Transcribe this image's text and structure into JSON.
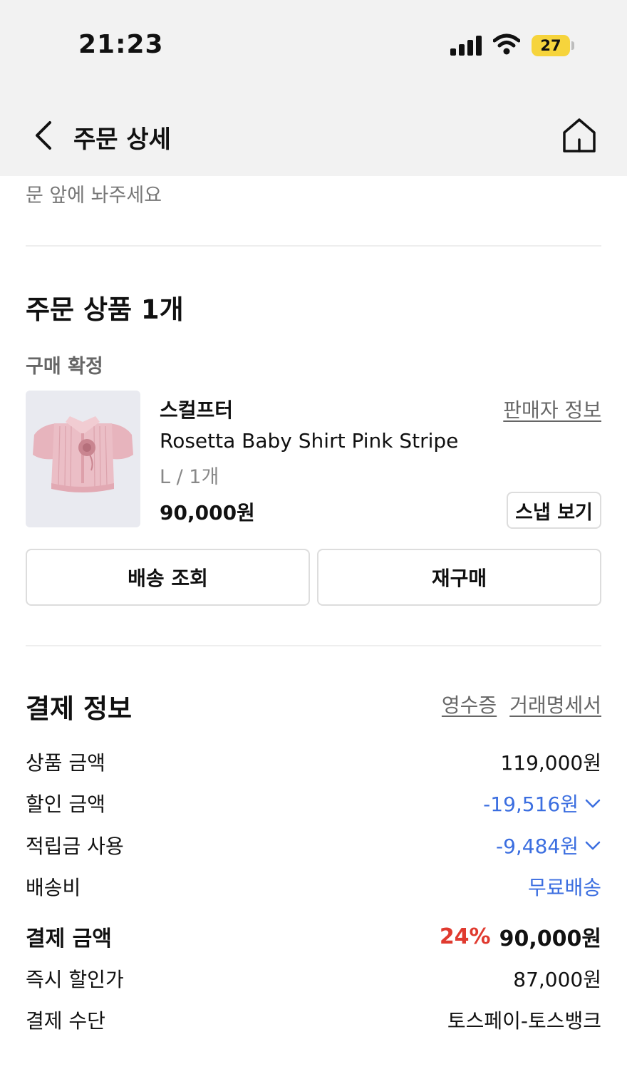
{
  "status_bar": {
    "time": "21:23",
    "battery": "27"
  },
  "nav": {
    "title": "주문 상세",
    "back_icon": "chevron-left-icon",
    "home_icon": "home-icon"
  },
  "previous_section": {
    "cut_text": "문 앞에 놔주세요"
  },
  "order_items": {
    "title": "주문 상품 1개",
    "status": "구매 확정",
    "item": {
      "brand": "스컬프터",
      "seller_link": "판매자 정보",
      "name": "Rosetta Baby Shirt Pink Stripe",
      "option": "L / 1개",
      "price": "90,000원",
      "snap_button": "스냅 보기",
      "thumbnail_colors": {
        "background": "#e9eaf0",
        "garment": "#e7b4bd"
      }
    },
    "buttons": {
      "track_delivery": "배송 조회",
      "reorder": "재구매"
    }
  },
  "payment": {
    "title": "결제 정보",
    "receipt_link": "영수증",
    "statement_link": "거래명세서",
    "rows": [
      {
        "label": "상품 금액",
        "value": "119,000원"
      },
      {
        "label": "할인 금액",
        "value": "-19,516원"
      },
      {
        "label": "적립금 사용",
        "value": "-9,484원"
      },
      {
        "label": "배송비",
        "value": "무료배송"
      }
    ],
    "total": {
      "label": "결제 금액",
      "discount_rate": "24%",
      "value": "90,000원"
    },
    "instant_discount": {
      "label": "즉시 할인가",
      "value": "87,000원"
    },
    "method": {
      "label": "결제 수단",
      "value": "토스페이-토스뱅크"
    }
  },
  "colors": {
    "accent_blue": "#3b6ee0",
    "discount_red": "#e03a2f",
    "header_bg": "#f2f2f2"
  }
}
